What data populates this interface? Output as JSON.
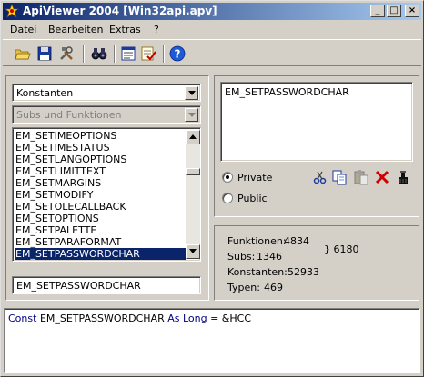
{
  "window": {
    "title": "ApiViewer 2004 [Win32api.apv]",
    "buttons": {
      "minimize": "_",
      "maximize": "□",
      "close": "×"
    }
  },
  "menu": [
    "Datei",
    "Bearbeiten",
    "Extras",
    "?"
  ],
  "toolbar": {
    "icons": [
      "open-folder-icon",
      "save-disk-icon",
      "tools-icon",
      "binoculars-find-icon",
      "window-list-icon",
      "notes-check-icon",
      "help-icon"
    ]
  },
  "left_panel": {
    "category_combo": "Konstanten",
    "subs_combo_placeholder": "Subs und Funktionen",
    "list_items": [
      "EM_SETIMEOPTIONS",
      "EM_SETIMESTATUS",
      "EM_SETLANGOPTIONS",
      "EM_SETLIMITTEXT",
      "EM_SETMARGINS",
      "EM_SETMODIFY",
      "EM_SETOLECALLBACK",
      "EM_SETOPTIONS",
      "EM_SETPALETTE",
      "EM_SETPARAFORMAT",
      "EM_SETPASSWORDCHAR"
    ],
    "selected_index": 10,
    "search_value": "EM_SETPASSWORDCHAR"
  },
  "right_panel": {
    "selection_text": "EM_SETPASSWORDCHAR",
    "scope_options": [
      "Private",
      "Public"
    ],
    "scope_selected": "Private",
    "action_icons": [
      "cut-icon",
      "copy-icon",
      "paste-icon",
      "delete-icon",
      "clear-icon"
    ]
  },
  "stats": {
    "funktionen_label": "Funktionen:",
    "funktionen_value": "4834",
    "subs_label": "Subs:",
    "subs_value": "1346",
    "total": "} 6180",
    "konstanten_label": "Konstanten:",
    "konstanten_value": "52933",
    "typen_label": "Typen:",
    "typen_value": "469"
  },
  "output": {
    "keyword1": "Const",
    "name": "EM_SETPASSWORDCHAR",
    "keyword2": "As Long",
    "value": "= &HCC"
  }
}
